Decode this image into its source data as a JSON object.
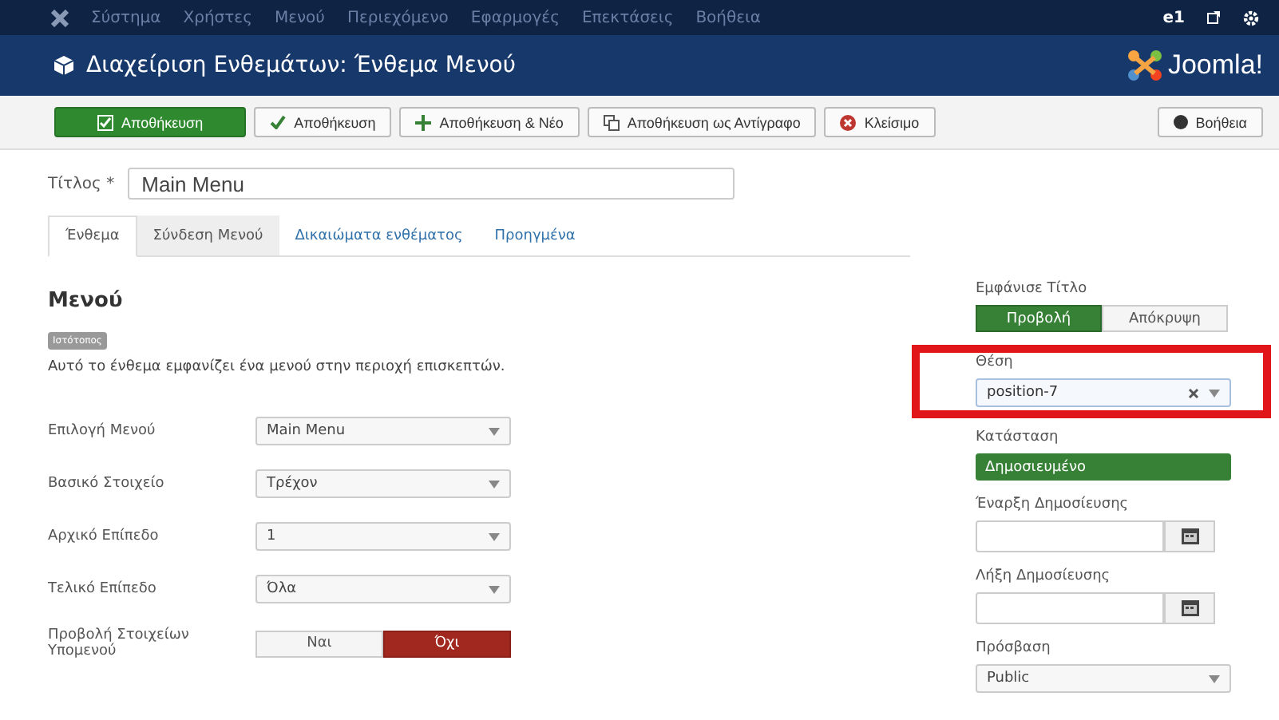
{
  "menu_bar": {
    "items": [
      "Σύστημα",
      "Χρήστες",
      "Μενού",
      "Περιεχόμενο",
      "Εφαρμογές",
      "Επεκτάσεις",
      "Βοήθεια"
    ],
    "user": "e1"
  },
  "header": {
    "title": "Διαχείριση Ενθεμάτων: Ένθεμα Μενού",
    "logo_text": "Joomla!"
  },
  "toolbar": {
    "buttons": [
      {
        "label": "Αποθήκευση",
        "kind": "apply"
      },
      {
        "label": "Αποθήκευση",
        "kind": "save"
      },
      {
        "label": "Αποθήκευση & Νέο",
        "kind": "new"
      },
      {
        "label": "Αποθήκευση ως Αντίγραφο",
        "kind": "copy"
      },
      {
        "label": "Κλείσιμο",
        "kind": "close"
      }
    ],
    "help": "Βοήθεια"
  },
  "title_field": {
    "label": "Τίτλος *",
    "value": "Main Menu"
  },
  "tabs": [
    {
      "label": "Ένθεμα",
      "selected": true
    },
    {
      "label": "Σύνδεση Μενού",
      "selected": false
    },
    {
      "label": "Δικαιώματα ενθέματος",
      "selected": false
    },
    {
      "label": "Προηγμένα",
      "selected": false
    }
  ],
  "module": {
    "heading": "Μενού",
    "badge": "Ιστότοπος",
    "description": "Αυτό το ένθεμα εμφανίζει ένα μενού στην περιοχή επισκεπτών."
  },
  "fields": [
    {
      "kind": "select",
      "label": "Επιλογή Μενού",
      "value": "Main Menu"
    },
    {
      "kind": "select",
      "label": "Βασικό Στοιχείο",
      "value": "Τρέχον"
    },
    {
      "kind": "select",
      "label": "Αρχικό Επίπεδο",
      "value": "1"
    },
    {
      "kind": "select",
      "label": "Τελικό Επίπεδο",
      "value": "Όλα"
    },
    {
      "kind": "toggle",
      "label": "Προβολή Στοιχείων Υπομενού",
      "options": [
        {
          "label": "Ναι",
          "kind": "yes",
          "selected": false
        },
        {
          "label": "Όχι",
          "kind": "no",
          "selected": true
        }
      ]
    }
  ],
  "sidebar": {
    "show_title": {
      "label": "Εμφάνισε Τίτλο",
      "options": [
        {
          "label": "Προβολή",
          "kind": "yes",
          "selected": true
        },
        {
          "label": "Απόκρυψη",
          "kind": "no",
          "selected": false
        }
      ]
    },
    "position": {
      "label": "Θέση",
      "value": "position-7",
      "highlighted": true
    },
    "status": {
      "label": "Κατάσταση",
      "value": "Δημοσιευμένο"
    },
    "publish_up": {
      "label": "Έναρξη Δημοσίευσης"
    },
    "publish_down": {
      "label": "Λήξη Δημοσίευσης"
    },
    "access": {
      "label": "Πρόσβαση",
      "value": "Public"
    }
  }
}
